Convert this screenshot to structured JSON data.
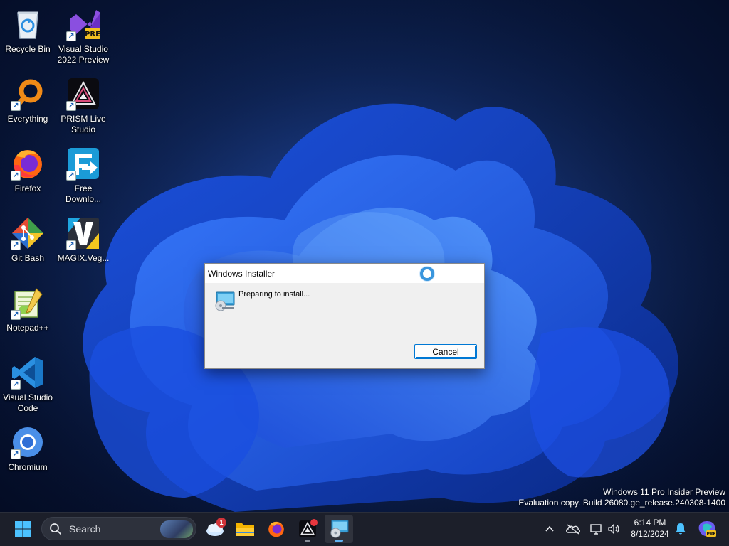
{
  "desktop": {
    "icons": [
      {
        "name": "recycle-bin",
        "label": "Recycle Bin",
        "icon": "recycle-bin-icon"
      },
      {
        "name": "visual-studio-2022-preview",
        "label": "Visual Studio 2022 Preview",
        "icon": "visual-studio-preview-icon",
        "badge": "PRE"
      },
      {
        "name": "everything",
        "label": "Everything",
        "icon": "everything-search-icon"
      },
      {
        "name": "prism-live-studio",
        "label": "PRISM Live Studio",
        "icon": "prism-icon"
      },
      {
        "name": "firefox",
        "label": "Firefox",
        "icon": "firefox-icon"
      },
      {
        "name": "free-download-manager",
        "label": "Free Downlo...",
        "icon": "download-manager-icon"
      },
      {
        "name": "git-bash",
        "label": "Git Bash",
        "icon": "git-bash-icon"
      },
      {
        "name": "magix-vegas",
        "label": "MAGIX.Veg...",
        "icon": "vegas-icon"
      },
      {
        "name": "notepad-plus-plus",
        "label": "Notepad++",
        "icon": "notepad-plus-plus-icon"
      },
      {
        "name": "visual-studio-code",
        "label": "Visual Studio Code",
        "icon": "vscode-icon"
      },
      {
        "name": "chromium",
        "label": "Chromium",
        "icon": "chromium-icon"
      }
    ],
    "watermark": {
      "line1": "Windows 11 Pro Insider Preview",
      "line2": "Evaluation copy. Build 26080.ge_release.240308-1400"
    }
  },
  "dialog": {
    "title": "Windows Installer",
    "message": "Preparing to install...",
    "cancel_label": "Cancel"
  },
  "taskbar": {
    "search_placeholder": "Search",
    "weather_badge": "1",
    "apps": [
      "start-icon",
      "weather-icon",
      "file-explorer-icon",
      "firefox-icon",
      "prism-icon",
      "windows-installer-icon"
    ],
    "tray": [
      "chevron-up-icon",
      "onedrive-off-icon",
      "network-icon",
      "volume-icon"
    ],
    "clock": {
      "time": "6:14 PM",
      "date": "8/12/2024"
    }
  },
  "colors": {
    "accent": "#0078d4",
    "taskbar": "#1c1f2a",
    "desktop": "#0b1d47"
  }
}
